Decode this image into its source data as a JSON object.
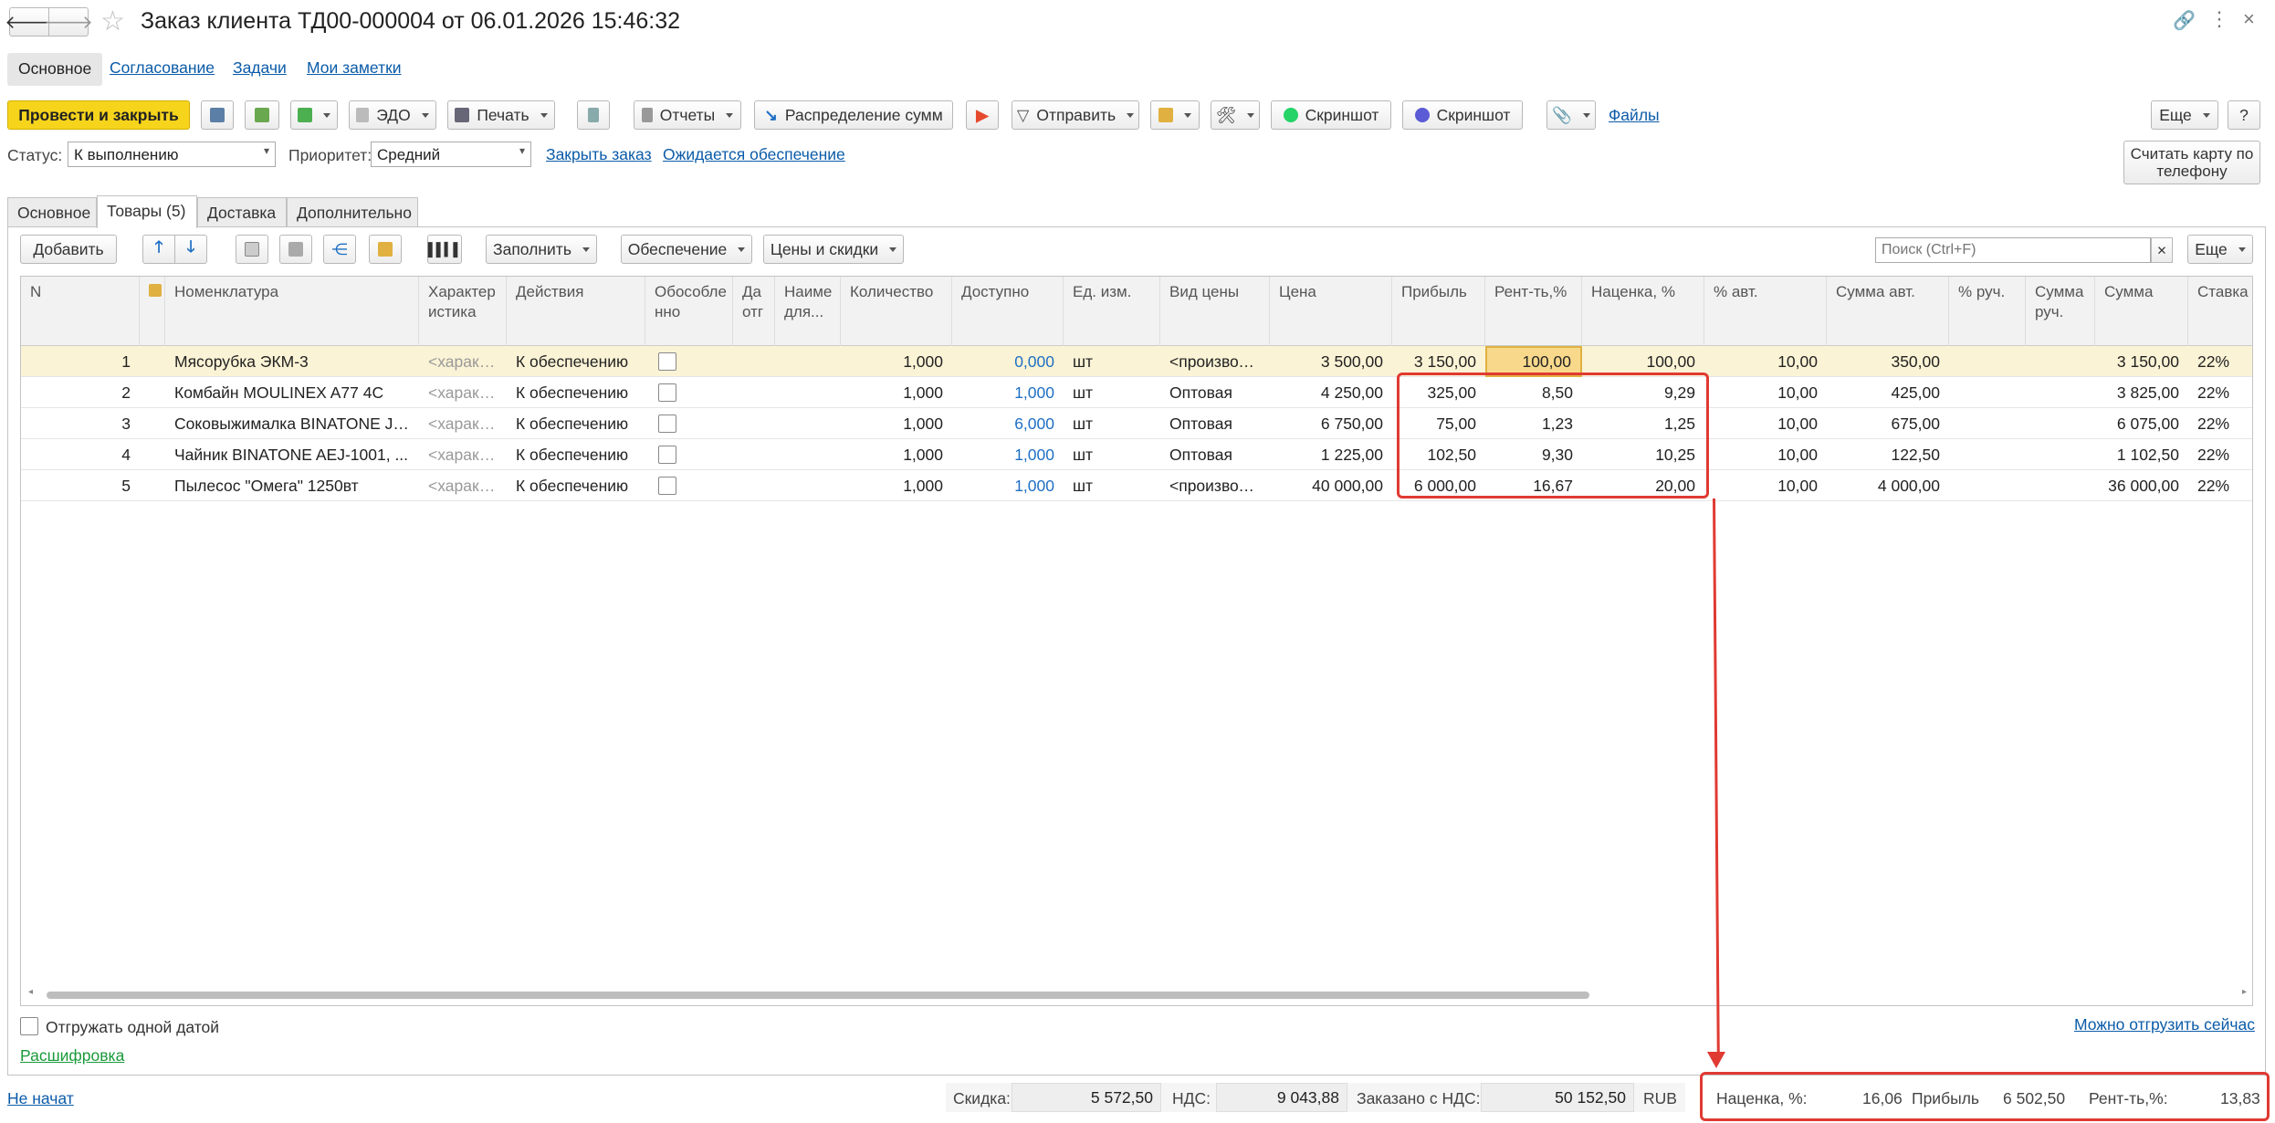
{
  "window": {
    "title": "Заказ клиента ТД00-000004 от 06.01.2026 15:46:32"
  },
  "nav_tabs": [
    "Основное",
    "Согласование",
    "Задачи",
    "Мои заметки"
  ],
  "toolbar": {
    "post_close": "Провести и закрыть",
    "edo": "ЭДО",
    "print": "Печать",
    "reports": "Отчеты",
    "distribute": "Распределение сумм",
    "send": "Отправить",
    "screenshot1": "Скриншот",
    "screenshot2": "Скриншот",
    "files": "Файлы",
    "more": "Еще",
    "help": "?"
  },
  "status": {
    "status_label": "Статус:",
    "status_value": "К выполнению",
    "priority_label": "Приоритет:",
    "priority_value": "Средний",
    "close_order": "Закрыть заказ",
    "awaiting": "Ожидается обеспечение",
    "scan_card": "Считать карту по телефону"
  },
  "doc_tabs": [
    "Основное",
    "Товары (5)",
    "Доставка",
    "Дополнительно"
  ],
  "goods_toolbar": {
    "add": "Добавить",
    "fill": "Заполнить",
    "provision": "Обеспечение",
    "prices": "Цены и скидки",
    "search_placeholder": "Поиск (Ctrl+F)",
    "more": "Еще"
  },
  "table": {
    "headers": [
      "N",
      "",
      "Номенклатура",
      "Характер истика",
      "Действия",
      "Обособле нно",
      "Да отг",
      "Наиме для...",
      "Количество",
      "Доступно",
      "Ед. изм.",
      "Вид цены",
      "Цена",
      "Прибыль",
      "Рент-ть,%",
      "Наценка, %",
      "% авт.",
      "Сумма авт.",
      "% руч.",
      "Сумма руч.",
      "Сумма",
      "Ставка"
    ],
    "rows": [
      {
        "n": "1",
        "name": "Мясорубка ЭКМ-3",
        "char": "<характ...",
        "action": "К обеспечению",
        "qty": "1,000",
        "avail": "0,000",
        "unit": "шт",
        "price_type": "<произвол...",
        "price": "3 500,00",
        "profit": "3 150,00",
        "rent": "100,00",
        "markup": "100,00",
        "pct_auto": "10,00",
        "sum_auto": "350,00",
        "pct_man": "",
        "sum_man": "",
        "sum": "3 150,00",
        "rate": "22%"
      },
      {
        "n": "2",
        "name": "Комбайн MOULINEX  A77 4C",
        "char": "<характ...",
        "action": "К обеспечению",
        "qty": "1,000",
        "avail": "1,000",
        "unit": "шт",
        "price_type": "Оптовая",
        "price": "4 250,00",
        "profit": "325,00",
        "rent": "8,50",
        "markup": "9,29",
        "pct_auto": "10,00",
        "sum_auto": "425,00",
        "pct_man": "",
        "sum_man": "",
        "sum": "3 825,00",
        "rate": "22%"
      },
      {
        "n": "3",
        "name": "Соковыжималка  BINATONE JE...",
        "char": "<характ...",
        "action": "К обеспечению",
        "qty": "1,000",
        "avail": "6,000",
        "unit": "шт",
        "price_type": "Оптовая",
        "price": "6 750,00",
        "profit": "75,00",
        "rent": "1,23",
        "markup": "1,25",
        "pct_auto": "10,00",
        "sum_auto": "675,00",
        "pct_man": "",
        "sum_man": "",
        "sum": "6 075,00",
        "rate": "22%"
      },
      {
        "n": "4",
        "name": "Чайник BINATONE  AEJ-1001, ...",
        "char": "<характ...",
        "action": "К обеспечению",
        "qty": "1,000",
        "avail": "1,000",
        "unit": "шт",
        "price_type": "Оптовая",
        "price": "1 225,00",
        "profit": "102,50",
        "rent": "9,30",
        "markup": "10,25",
        "pct_auto": "10,00",
        "sum_auto": "122,50",
        "pct_man": "",
        "sum_man": "",
        "sum": "1 102,50",
        "rate": "22%"
      },
      {
        "n": "5",
        "name": "Пылесос \"Омега\" 1250вт",
        "char": "<характ...",
        "action": "К обеспечению",
        "qty": "1,000",
        "avail": "1,000",
        "unit": "шт",
        "price_type": "<произвол...",
        "price": "40 000,00",
        "profit": "6 000,00",
        "rent": "16,67",
        "markup": "20,00",
        "pct_auto": "10,00",
        "sum_auto": "4 000,00",
        "pct_man": "",
        "sum_man": "",
        "sum": "36 000,00",
        "rate": "22%"
      }
    ]
  },
  "bottom": {
    "ship_one_date": "Отгружать одной датой",
    "breakdown": "Расшифровка",
    "can_ship": "Можно отгрузить сейчас"
  },
  "footer": {
    "not_started": "Не начат",
    "discount_label": "Скидка:",
    "discount": "5 572,50",
    "vat_label": "НДС:",
    "vat": "9 043,88",
    "ordered_label": "Заказано с НДС:",
    "ordered": "50 152,50",
    "currency": "RUB",
    "markup_label": "Наценка, %:",
    "markup": "16,06",
    "profit_label": "Прибыль",
    "profit": "6 502,50",
    "rent_label": "Рент-ть,%:",
    "rent": "13,83"
  },
  "colors": {
    "accent_yellow": "#f6d41c",
    "link": "#0b5ba8",
    "highlight": "#e03a32",
    "row_selected": "#fbf3d5"
  }
}
